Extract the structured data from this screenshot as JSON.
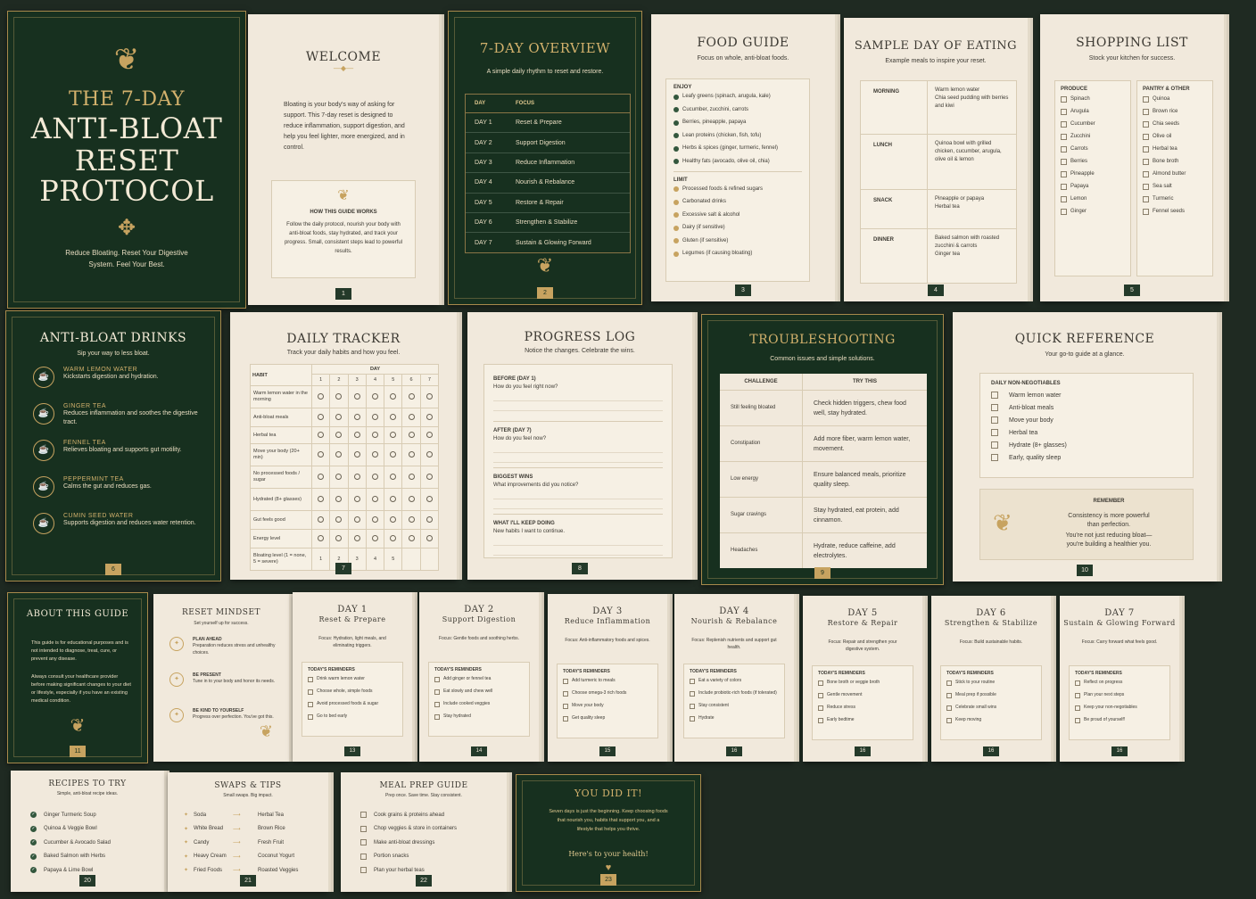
{
  "p0": {
    "title_l1": "THE 7-DAY",
    "title_l2": "ANTI-BLOAT",
    "title_l3": "RESET",
    "title_l4": "PROTOCOL",
    "tagline_l1": "Reduce Bloating. Reset Your Digestive",
    "tagline_l2": "System. Feel Your Best."
  },
  "p1": {
    "title": "WELCOME",
    "body": "Bloating is your body's way of asking for support. This 7-day reset is designed to reduce inflammation, support digestion, and help you feel lighter, more energized, and in control.",
    "box_title": "HOW THIS GUIDE WORKS",
    "box_body": "Follow the daily protocol, nourish your body with anti-bloat foods, stay hydrated, and track your progress. Small, consistent steps lead to powerful results.",
    "num": "1"
  },
  "p2": {
    "title": "7-DAY OVERVIEW",
    "sub": "A simple daily rhythm to reset and restore.",
    "col_day": "DAY",
    "col_focus": "FOCUS",
    "rows": [
      {
        "day": "DAY 1",
        "focus": "Reset & Prepare"
      },
      {
        "day": "DAY 2",
        "focus": "Support Digestion"
      },
      {
        "day": "DAY 3",
        "focus": "Reduce Inflammation"
      },
      {
        "day": "DAY 4",
        "focus": "Nourish & Rebalance"
      },
      {
        "day": "DAY 5",
        "focus": "Restore & Repair"
      },
      {
        "day": "DAY 6",
        "focus": "Strengthen & Stabilize"
      },
      {
        "day": "DAY 7",
        "focus": "Sustain & Glowing Forward"
      }
    ],
    "num": "2"
  },
  "p3": {
    "title": "FOOD GUIDE",
    "sub": "Focus on whole, anti-bloat foods.",
    "enjoy_label": "ENJOY",
    "enjoy": [
      "Leafy greens (spinach, arugula, kale)",
      "Cucumber, zucchini, carrots",
      "Berries, pineapple, papaya",
      "Lean proteins (chicken, fish, tofu)",
      "Herbs & spices (ginger, turmeric, fennel)",
      "Healthy fats (avocado, olive oil, chia)"
    ],
    "limit_label": "LIMIT",
    "limit": [
      "Processed foods & refined sugars",
      "Carbonated drinks",
      "Excessive salt & alcohol",
      "Dairy (if sensitive)",
      "Gluten (if sensitive)",
      "Legumes (if causing bloating)"
    ],
    "num": "3"
  },
  "p4": {
    "title": "SAMPLE DAY OF EATING",
    "sub": "Example meals to inspire your reset.",
    "meals": [
      {
        "name": "MORNING",
        "items": [
          "Warm lemon water",
          "Chia seed pudding with berries and kiwi"
        ]
      },
      {
        "name": "LUNCH",
        "items": [
          "Quinoa bowl with grilled chicken, cucumber, arugula, olive oil & lemon"
        ]
      },
      {
        "name": "SNACK",
        "items": [
          "Pineapple or papaya",
          "Herbal tea"
        ]
      },
      {
        "name": "DINNER",
        "items": [
          "Baked salmon with roasted zucchini & carrots",
          "Ginger tea"
        ]
      }
    ],
    "num": "4"
  },
  "p5": {
    "title": "SHOPPING LIST",
    "sub": "Stock your kitchen for success.",
    "produce_label": "PRODUCE",
    "produce": [
      "Spinach",
      "Arugula",
      "Cucumber",
      "Zucchini",
      "Carrots",
      "Berries",
      "Pineapple",
      "Papaya",
      "Lemon",
      "Ginger"
    ],
    "pantry_label": "PANTRY & OTHER",
    "pantry": [
      "Quinoa",
      "Brown rice",
      "Chia seeds",
      "Olive oil",
      "Herbal tea",
      "Bone broth",
      "Almond butter",
      "Sea salt",
      "Turmeric",
      "Fennel seeds"
    ],
    "num": "5"
  },
  "p6": {
    "title": "ANTI-BLOAT DRINKS",
    "sub": "Sip your way to less bloat.",
    "drinks": [
      {
        "name": "WARM LEMON WATER",
        "desc": "Kickstarts digestion and hydration."
      },
      {
        "name": "GINGER TEA",
        "desc": "Reduces inflammation and soothes the digestive tract."
      },
      {
        "name": "FENNEL TEA",
        "desc": "Relieves bloating and supports gut motility."
      },
      {
        "name": "PEPPERMINT TEA",
        "desc": "Calms the gut and reduces gas."
      },
      {
        "name": "CUMIN SEED WATER",
        "desc": "Supports digestion and reduces water retention."
      }
    ],
    "num": "6"
  },
  "p7": {
    "title": "DAILY TRACKER",
    "sub": "Track your daily habits and how you feel.",
    "col_habit": "HABIT",
    "col_day": "DAY",
    "days": [
      "1",
      "2",
      "3",
      "4",
      "5",
      "6",
      "7"
    ],
    "habits": [
      "Warm lemon water in the morning",
      "Anti-bloat meals",
      "Herbal tea",
      "Move your body (20+ min)",
      "No processed foods / sugar",
      "Hydrated (8+ glasses)",
      "Gut feels good",
      "Energy level",
      "Bloating level (1 = none, 5 = severe)"
    ],
    "scale": [
      "1",
      "2",
      "3",
      "4",
      "5"
    ],
    "num": "7"
  },
  "p8": {
    "title": "PROGRESS LOG",
    "sub": "Notice the changes. Celebrate the wins.",
    "sections": [
      {
        "label": "BEFORE (DAY 1)",
        "q": "How do you feel right now?"
      },
      {
        "label": "AFTER (DAY 7)",
        "q": "How do you feel now?"
      },
      {
        "label": "BIGGEST WINS",
        "q": "What improvements did you notice?"
      },
      {
        "label": "WHAT I'LL KEEP DOING",
        "q": "New habits I want to continue."
      }
    ],
    "num": "8"
  },
  "p9": {
    "title": "TROUBLESHOOTING",
    "sub": "Common issues and simple solutions.",
    "col_a": "CHALLENGE",
    "col_b": "TRY THIS",
    "rows": [
      {
        "a": "Still feeling bloated",
        "b": "Check hidden triggers, chew food well, stay hydrated."
      },
      {
        "a": "Constipation",
        "b": "Add more fiber, warm lemon water, movement."
      },
      {
        "a": "Low energy",
        "b": "Ensure balanced meals, prioritize quality sleep."
      },
      {
        "a": "Sugar cravings",
        "b": "Stay hydrated, eat protein, add cinnamon."
      },
      {
        "a": "Headaches",
        "b": "Hydrate, reduce caffeine, add electrolytes."
      }
    ],
    "num": "9"
  },
  "p10": {
    "title": "QUICK REFERENCE",
    "sub": "Your go-to guide at a glance.",
    "list_label": "DAILY NON-NEGOTIABLES",
    "items": [
      "Warm lemon water",
      "Anti-bloat meals",
      "Move your body",
      "Herbal tea",
      "Hydrate (8+ glasses)",
      "Early, quality sleep"
    ],
    "rem_label": "REMEMBER",
    "rem_l1": "Consistency is more powerful",
    "rem_l2": "than perfection.",
    "rem_l3": "You're not just reducing bloat—",
    "rem_l4": "you're building a healthier you.",
    "num": "10"
  },
  "p11": {
    "title": "ABOUT THIS GUIDE",
    "body1": "This guide is for educational purposes and is not intended to diagnose, treat, cure, or prevent any disease.",
    "body2": "Always consult your healthcare provider before making significant changes to your diet or lifestyle, especially if you have an existing medical condition.",
    "num": "11"
  },
  "p12": {
    "title": "RESET MINDSET",
    "sub": "Set yourself up for success.",
    "items": [
      {
        "h": "PLAN AHEAD",
        "t": "Preparation reduces stress and unhealthy choices."
      },
      {
        "h": "BE PRESENT",
        "t": "Tune in to your body and honor its needs."
      },
      {
        "h": "BE KIND TO YOURSELF",
        "t": "Progress over perfection. You've got this."
      }
    ]
  },
  "days": [
    {
      "day": "DAY 1",
      "name": "Reset & Prepare",
      "focus": "Focus: Hydration, light meals, and eliminating triggers.",
      "rem": [
        "Drink warm lemon water",
        "Choose whole, simple foods",
        "Avoid processed foods & sugar",
        "Go to bed early"
      ],
      "num": "13"
    },
    {
      "day": "DAY 2",
      "name": "Support Digestion",
      "focus": "Focus: Gentle foods and soothing herbs.",
      "rem": [
        "Add ginger or fennel tea",
        "Eat slowly and chew well",
        "Include cooked veggies",
        "Stay hydrated"
      ],
      "num": "14"
    },
    {
      "day": "DAY 3",
      "name": "Reduce Inflammation",
      "focus": "Focus: Anti-inflammatory foods and spices.",
      "rem": [
        "Add turmeric to meals",
        "Choose omega-3 rich foods",
        "Move your body",
        "Get quality sleep"
      ],
      "num": "15"
    },
    {
      "day": "DAY 4",
      "name": "Nourish & Rebalance",
      "focus": "Focus: Replenish nutrients and support gut health.",
      "rem": [
        "Eat a variety of colors",
        "Include probiotic-rich foods (if tolerated)",
        "Stay consistent",
        "Hydrate"
      ],
      "num": "16"
    },
    {
      "day": "DAY 5",
      "name": "Restore & Repair",
      "focus": "Focus: Repair and strengthen your digestive system.",
      "rem": [
        "Bone broth or veggie broth",
        "Gentle movement",
        "Reduce stress",
        "Early bedtime"
      ],
      "num": "16"
    },
    {
      "day": "DAY 6",
      "name": "Strengthen & Stabilize",
      "focus": "Focus: Build sustainable habits.",
      "rem": [
        "Stick to your routine",
        "Meal prep if possible",
        "Celebrate small wins",
        "Keep moving"
      ],
      "num": "16"
    },
    {
      "day": "DAY 7",
      "name": "Sustain & Glowing Forward",
      "focus": "Focus: Carry forward what feels good.",
      "rem": [
        "Reflect on progress",
        "Plan your next steps",
        "Keep your non-negotiables",
        "Be proud of yourself!"
      ],
      "num": "16"
    }
  ],
  "reminders_label": "TODAY'S REMINDERS",
  "p20": {
    "title": "RECIPES TO TRY",
    "sub": "Simple, anti-bloat recipe ideas.",
    "items": [
      "Ginger Turmeric Soup",
      "Quinoa & Veggie Bowl",
      "Cucumber & Avocado Salad",
      "Baked Salmon with Herbs",
      "Papaya & Lime Bowl"
    ],
    "num": "20"
  },
  "p21": {
    "title": "SWAPS & TIPS",
    "sub": "Small swaps. Big impact.",
    "swaps": [
      {
        "from": "Soda",
        "to": "Herbal Tea"
      },
      {
        "from": "White Bread",
        "to": "Brown Rice"
      },
      {
        "from": "Candy",
        "to": "Fresh Fruit"
      },
      {
        "from": "Heavy Cream",
        "to": "Coconut Yogurt"
      },
      {
        "from": "Fried Foods",
        "to": "Roasted Veggies"
      }
    ],
    "num": "21"
  },
  "p22": {
    "title": "MEAL PREP GUIDE",
    "sub": "Prep once. Save time. Stay consistent.",
    "items": [
      "Cook grains & proteins ahead",
      "Chop veggies & store in containers",
      "Make anti-bloat dressings",
      "Portion snacks",
      "Plan your herbal teas"
    ],
    "num": "22"
  },
  "p23": {
    "title": "YOU DID IT!",
    "body": "Seven days is just the beginning. Keep choosing foods that nourish you, habits that support you, and a lifestyle that helps you thrive.",
    "closing": "Here's to your health!",
    "num": "23"
  },
  "colors": {
    "bg": "#1f2a22",
    "dark_green": "#17301f",
    "cream": "#f1e9dc",
    "gold": "#c7a360"
  }
}
